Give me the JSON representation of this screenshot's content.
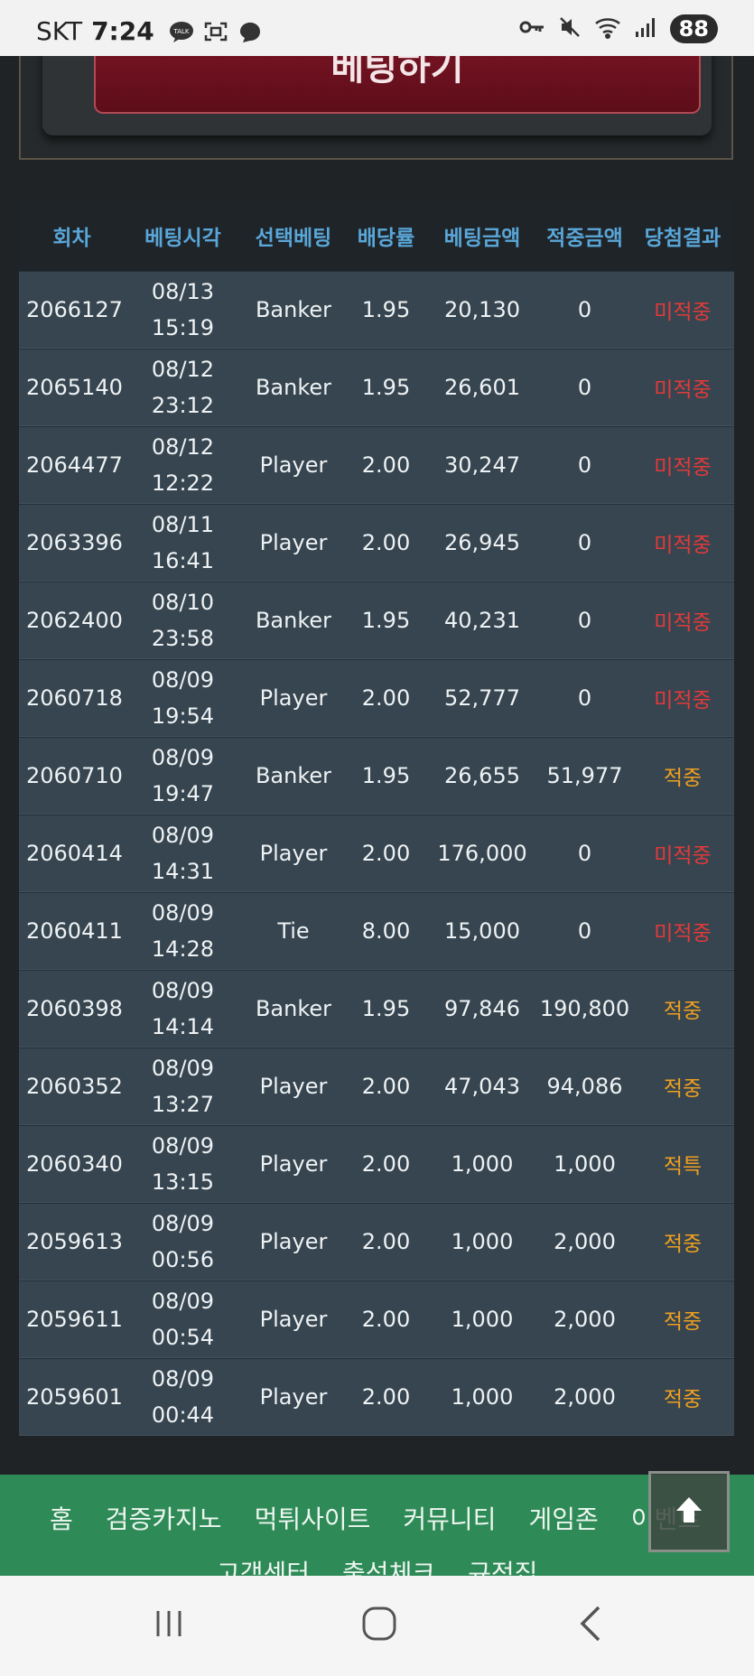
{
  "status_bar": {
    "carrier": "SKT",
    "time": "7:24",
    "battery": "88"
  },
  "bet_button_label": "베팅하기",
  "table": {
    "headers": [
      "회차",
      "베팅시각",
      "선택베팅",
      "배당률",
      "베팅금액",
      "적중금액",
      "당첨결과"
    ],
    "rows": [
      {
        "round": "2066127",
        "date": "08/13",
        "time": "15:19",
        "choice": "Banker",
        "odds": "1.95",
        "bet": "20,130",
        "payout": "0",
        "result": "미적중",
        "win": false
      },
      {
        "round": "2065140",
        "date": "08/12",
        "time": "23:12",
        "choice": "Banker",
        "odds": "1.95",
        "bet": "26,601",
        "payout": "0",
        "result": "미적중",
        "win": false
      },
      {
        "round": "2064477",
        "date": "08/12",
        "time": "12:22",
        "choice": "Player",
        "odds": "2.00",
        "bet": "30,247",
        "payout": "0",
        "result": "미적중",
        "win": false
      },
      {
        "round": "2063396",
        "date": "08/11",
        "time": "16:41",
        "choice": "Player",
        "odds": "2.00",
        "bet": "26,945",
        "payout": "0",
        "result": "미적중",
        "win": false
      },
      {
        "round": "2062400",
        "date": "08/10",
        "time": "23:58",
        "choice": "Banker",
        "odds": "1.95",
        "bet": "40,231",
        "payout": "0",
        "result": "미적중",
        "win": false
      },
      {
        "round": "2060718",
        "date": "08/09",
        "time": "19:54",
        "choice": "Player",
        "odds": "2.00",
        "bet": "52,777",
        "payout": "0",
        "result": "미적중",
        "win": false
      },
      {
        "round": "2060710",
        "date": "08/09",
        "time": "19:47",
        "choice": "Banker",
        "odds": "1.95",
        "bet": "26,655",
        "payout": "51,977",
        "result": "적중",
        "win": true
      },
      {
        "round": "2060414",
        "date": "08/09",
        "time": "14:31",
        "choice": "Player",
        "odds": "2.00",
        "bet": "176,000",
        "payout": "0",
        "result": "미적중",
        "win": false
      },
      {
        "round": "2060411",
        "date": "08/09",
        "time": "14:28",
        "choice": "Tie",
        "odds": "8.00",
        "bet": "15,000",
        "payout": "0",
        "result": "미적중",
        "win": false
      },
      {
        "round": "2060398",
        "date": "08/09",
        "time": "14:14",
        "choice": "Banker",
        "odds": "1.95",
        "bet": "97,846",
        "payout": "190,800",
        "result": "적중",
        "win": true
      },
      {
        "round": "2060352",
        "date": "08/09",
        "time": "13:27",
        "choice": "Player",
        "odds": "2.00",
        "bet": "47,043",
        "payout": "94,086",
        "result": "적중",
        "win": true
      },
      {
        "round": "2060340",
        "date": "08/09",
        "time": "13:15",
        "choice": "Player",
        "odds": "2.00",
        "bet": "1,000",
        "payout": "1,000",
        "result": "적특",
        "win": true
      },
      {
        "round": "2059613",
        "date": "08/09",
        "time": "00:56",
        "choice": "Player",
        "odds": "2.00",
        "bet": "1,000",
        "payout": "2,000",
        "result": "적중",
        "win": true
      },
      {
        "round": "2059611",
        "date": "08/09",
        "time": "00:54",
        "choice": "Player",
        "odds": "2.00",
        "bet": "1,000",
        "payout": "2,000",
        "result": "적중",
        "win": true
      },
      {
        "round": "2059601",
        "date": "08/09",
        "time": "00:44",
        "choice": "Player",
        "odds": "2.00",
        "bet": "1,000",
        "payout": "2,000",
        "result": "적중",
        "win": true
      }
    ]
  },
  "footer_nav": {
    "row1": [
      "홈",
      "검증카지노",
      "먹튀사이트",
      "커뮤니티",
      "게임존",
      "이벤트"
    ],
    "row2": [
      "고객센터",
      "출석체크",
      "규정집"
    ]
  },
  "colors": {
    "header_text": "#59a6d8",
    "lose": "#e23a3a",
    "win": "#f0a020",
    "footer_bg": "#2e8b57",
    "bet_button": "#6b1020"
  },
  "icons": {
    "statusbar": [
      "talk-icon",
      "screenshot-icon",
      "chat-icon",
      "key-icon",
      "mute-icon",
      "wifi-icon",
      "signal-icon"
    ],
    "scroll_top": "arrow-up-icon",
    "navbar": [
      "recent-apps-icon",
      "home-icon",
      "back-icon"
    ]
  }
}
